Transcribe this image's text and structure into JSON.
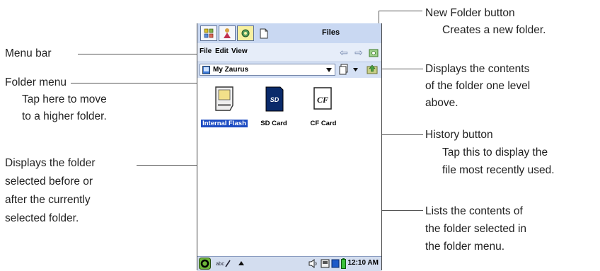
{
  "callouts": {
    "new_folder": {
      "title": "New Folder button",
      "desc": "Creates a new folder."
    },
    "menu_bar": "Menu bar",
    "folder_menu": {
      "title": "Folder menu",
      "desc_1": "Tap here to move",
      "desc_2": "to a higher folder."
    },
    "up_folder": {
      "line_1": "Displays the contents",
      "line_2": "of the folder one level",
      "line_3": "above."
    },
    "history": {
      "title": "History button",
      "desc_1": "Tap this to display the",
      "desc_2": "file most recently used."
    },
    "back_forward": {
      "line_1": "Displays the folder",
      "line_2": "selected before or",
      "line_3": "after the currently",
      "line_4": "selected folder."
    },
    "list": {
      "line_1": "Lists the contents of",
      "line_2": "the folder selected in",
      "line_3": "the folder menu."
    }
  },
  "app": {
    "title": "Files",
    "menu": {
      "file": "File",
      "edit": "Edit",
      "view": "View"
    },
    "folder_select": {
      "value": "My Zaurus"
    },
    "items": [
      {
        "label": "Internal Flash",
        "icon": "internal-flash-icon",
        "selected": true
      },
      {
        "label": "SD Card",
        "icon": "sd-card-icon",
        "selected": false
      },
      {
        "label": "CF Card",
        "icon": "cf-card-icon",
        "selected": false
      }
    ],
    "taskbar": {
      "input": "abc",
      "clock": "12:10 AM"
    }
  },
  "colors": {
    "selection": "#1d4cc2",
    "tabbar": "#c9d8f2",
    "menubar": "#e6edf9"
  }
}
